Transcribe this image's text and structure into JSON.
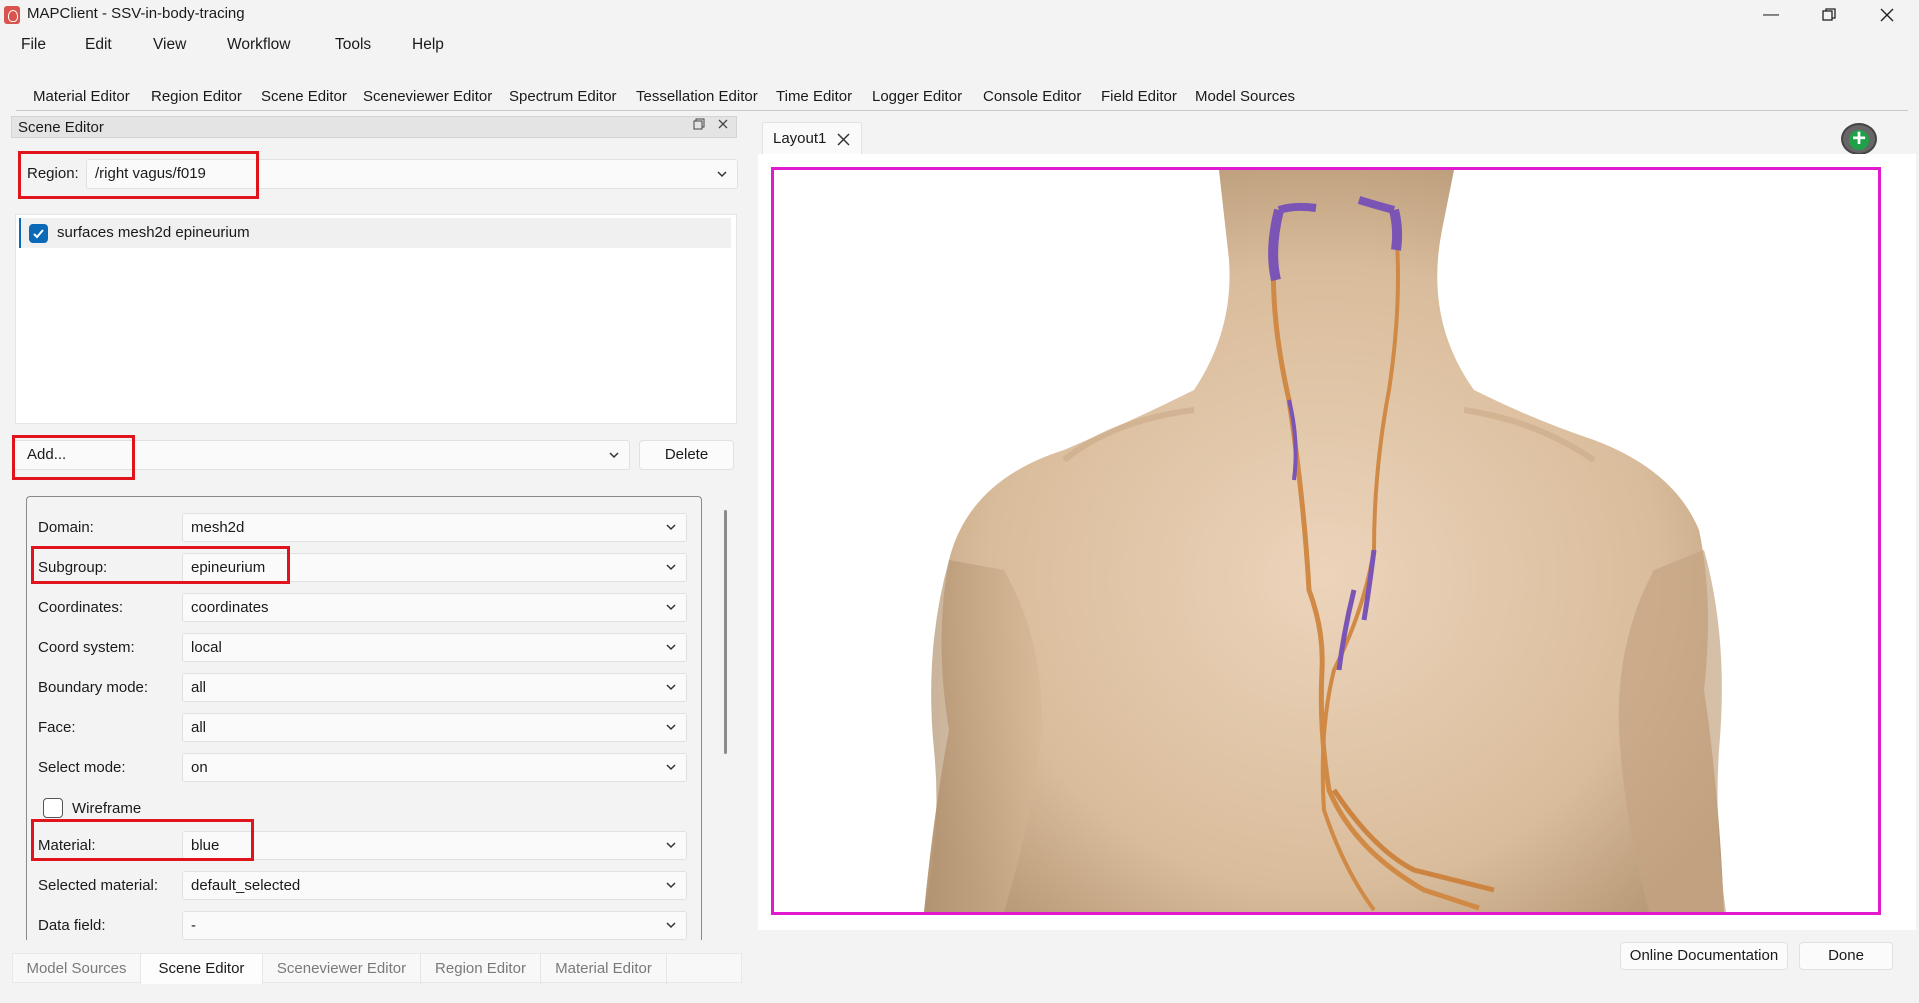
{
  "window": {
    "title": "MAPClient - SSV-in-body-tracing",
    "controls": [
      "minimize-icon",
      "restore-icon",
      "close-icon"
    ]
  },
  "menu": [
    "File",
    "Edit",
    "View",
    "Workflow",
    "Tools",
    "Help"
  ],
  "toolbar": {
    "items": [
      {
        "label": "Material Editor",
        "active": true
      },
      {
        "label": "Region Editor",
        "active": true
      },
      {
        "label": "Scene Editor",
        "active": true
      },
      {
        "label": "Sceneviewer Editor",
        "active": true
      },
      {
        "label": "Spectrum Editor",
        "active": false
      },
      {
        "label": "Tessellation Editor",
        "active": false
      },
      {
        "label": "Time Editor",
        "active": false
      },
      {
        "label": "Logger Editor",
        "active": false
      },
      {
        "label": "Console Editor",
        "active": false
      },
      {
        "label": "Field Editor",
        "active": false
      },
      {
        "label": "Model Sources",
        "active": true
      }
    ],
    "accent_color": "#0b6ab8"
  },
  "scene_editor": {
    "title": "Scene Editor",
    "region_label": "Region:",
    "region_value": "/right vagus/f019",
    "graphics_list": [
      {
        "label": "surfaces mesh2d epineurium",
        "checked": true
      }
    ],
    "add_placeholder": "Add...",
    "delete_label": "Delete",
    "properties": {
      "domain": {
        "label": "Domain:",
        "value": "mesh2d"
      },
      "subgroup": {
        "label": "Subgroup:",
        "value": "epineurium"
      },
      "coordinates": {
        "label": "Coordinates:",
        "value": "coordinates"
      },
      "coord_system": {
        "label": "Coord system:",
        "value": "local"
      },
      "boundary_mode": {
        "label": "Boundary mode:",
        "value": "all"
      },
      "face": {
        "label": "Face:",
        "value": "all"
      },
      "select_mode": {
        "label": "Select mode:",
        "value": "on"
      },
      "wireframe": {
        "label": "Wireframe",
        "checked": false
      },
      "material": {
        "label": "Material:",
        "value": "blue"
      },
      "selected_material": {
        "label": "Selected material:",
        "value": "default_selected"
      },
      "data_field": {
        "label": "Data field:",
        "value": "-"
      }
    }
  },
  "bottom_tabs": [
    {
      "label": "Model Sources",
      "active": false
    },
    {
      "label": "Scene Editor",
      "active": true
    },
    {
      "label": "Sceneviewer Editor",
      "active": false
    },
    {
      "label": "Region Editor",
      "active": false
    },
    {
      "label": "Material Editor",
      "active": false
    }
  ],
  "layout_tab": {
    "label": "Layout1"
  },
  "viewport": {
    "border_color": "#e11ad0",
    "body_color": "#dcc3a6",
    "nerve_colors": [
      "#d08a45",
      "#7b55b5"
    ]
  },
  "footer": {
    "docs_label": "Online Documentation",
    "done_label": "Done"
  },
  "highlight_color": "#e0141c"
}
